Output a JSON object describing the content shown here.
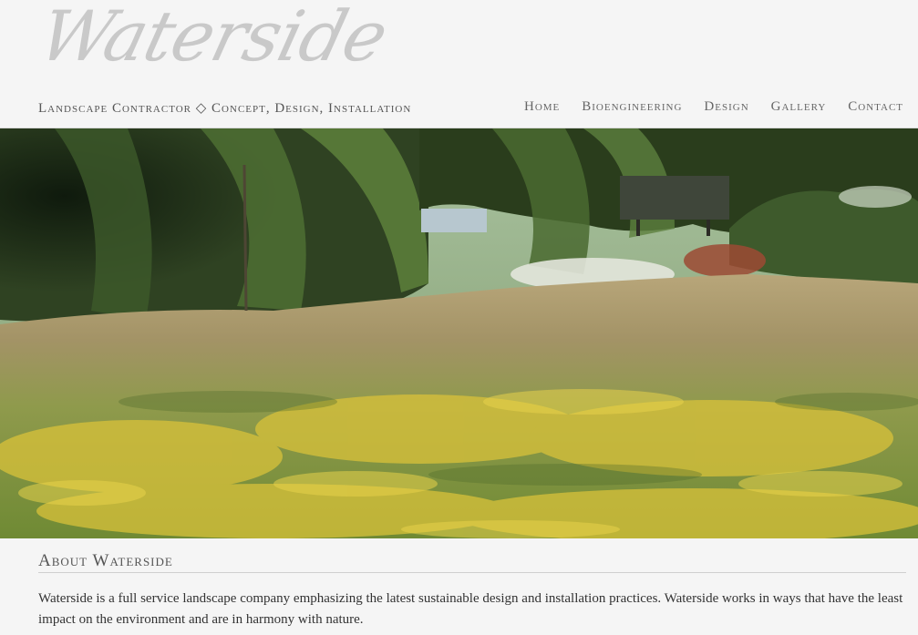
{
  "header": {
    "logo_text": "Waterside",
    "tagline": "Landscape Contractor ◇ Concept, Design, Installation"
  },
  "nav": {
    "items": [
      {
        "label": "Home"
      },
      {
        "label": "Bioengineering"
      },
      {
        "label": "Design"
      },
      {
        "label": "Gallery"
      },
      {
        "label": "Contact"
      }
    ]
  },
  "hero": {
    "subject": "meadow-landscape-photo"
  },
  "about": {
    "title": "About Waterside",
    "text": "Waterside is a full service landscape company emphasizing the latest sustainable design and installation practices. Waterside works in ways that have the least impact on the environment and are in harmony with nature."
  },
  "colors": {
    "background": "#f5f5f5",
    "logo": "#c9c9c9",
    "nav_text": "#666666",
    "body_text": "#333333"
  }
}
